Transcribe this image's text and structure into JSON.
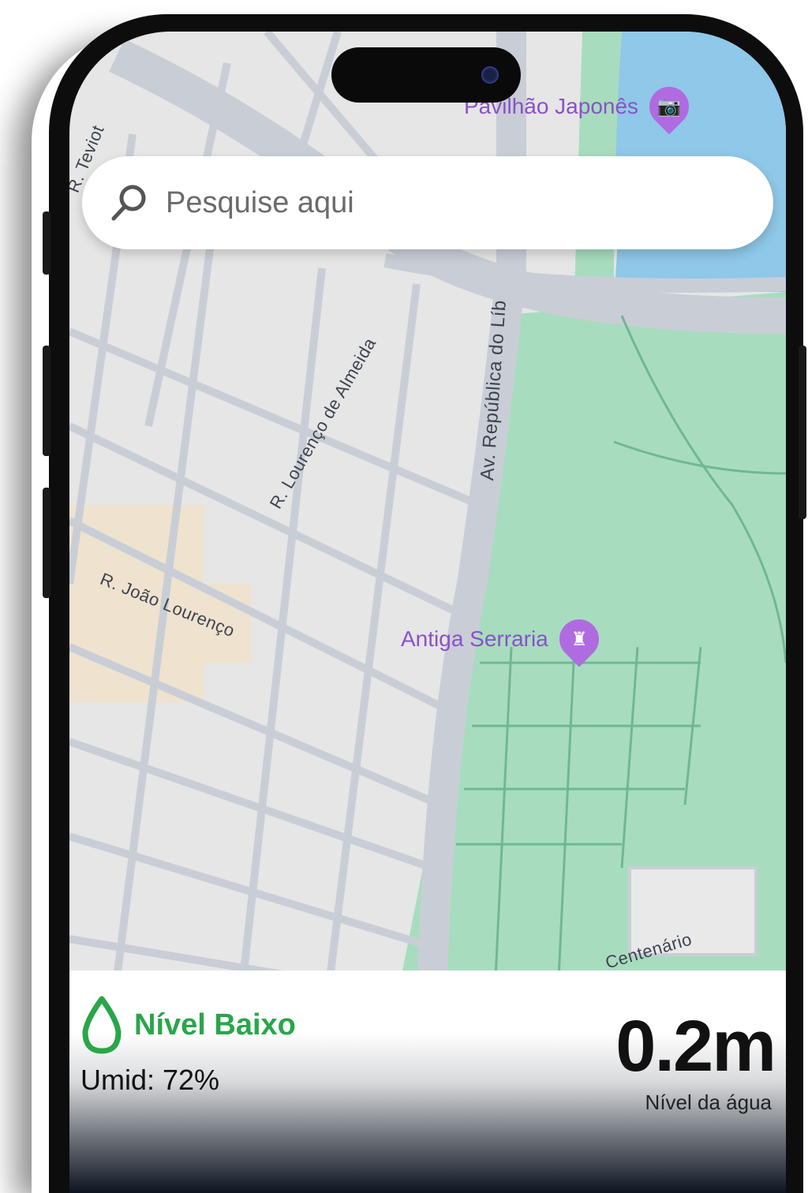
{
  "search": {
    "placeholder": "Pesquise aqui"
  },
  "map": {
    "streets": [
      "R. Teviot",
      "R. Lourenço de Almeida",
      "Av. República do Líb",
      "R. João Lourenço",
      "Centenário"
    ],
    "pois": [
      {
        "name": "Pavilhão Japonês",
        "icon": "camera-icon"
      },
      {
        "name": "Antiga Serraria",
        "icon": "castle-icon"
      }
    ],
    "colors": {
      "park": "#a8dcbf",
      "water": "#8fc8e8",
      "road": "#c9ced6",
      "poi": "#8a52c7"
    }
  },
  "panel": {
    "status_label": "Nível Baixo",
    "humidity": "Umid: 72%",
    "water_level": "0.2m",
    "water_level_caption": "Nível da água",
    "status_color": "#2aa64a"
  }
}
